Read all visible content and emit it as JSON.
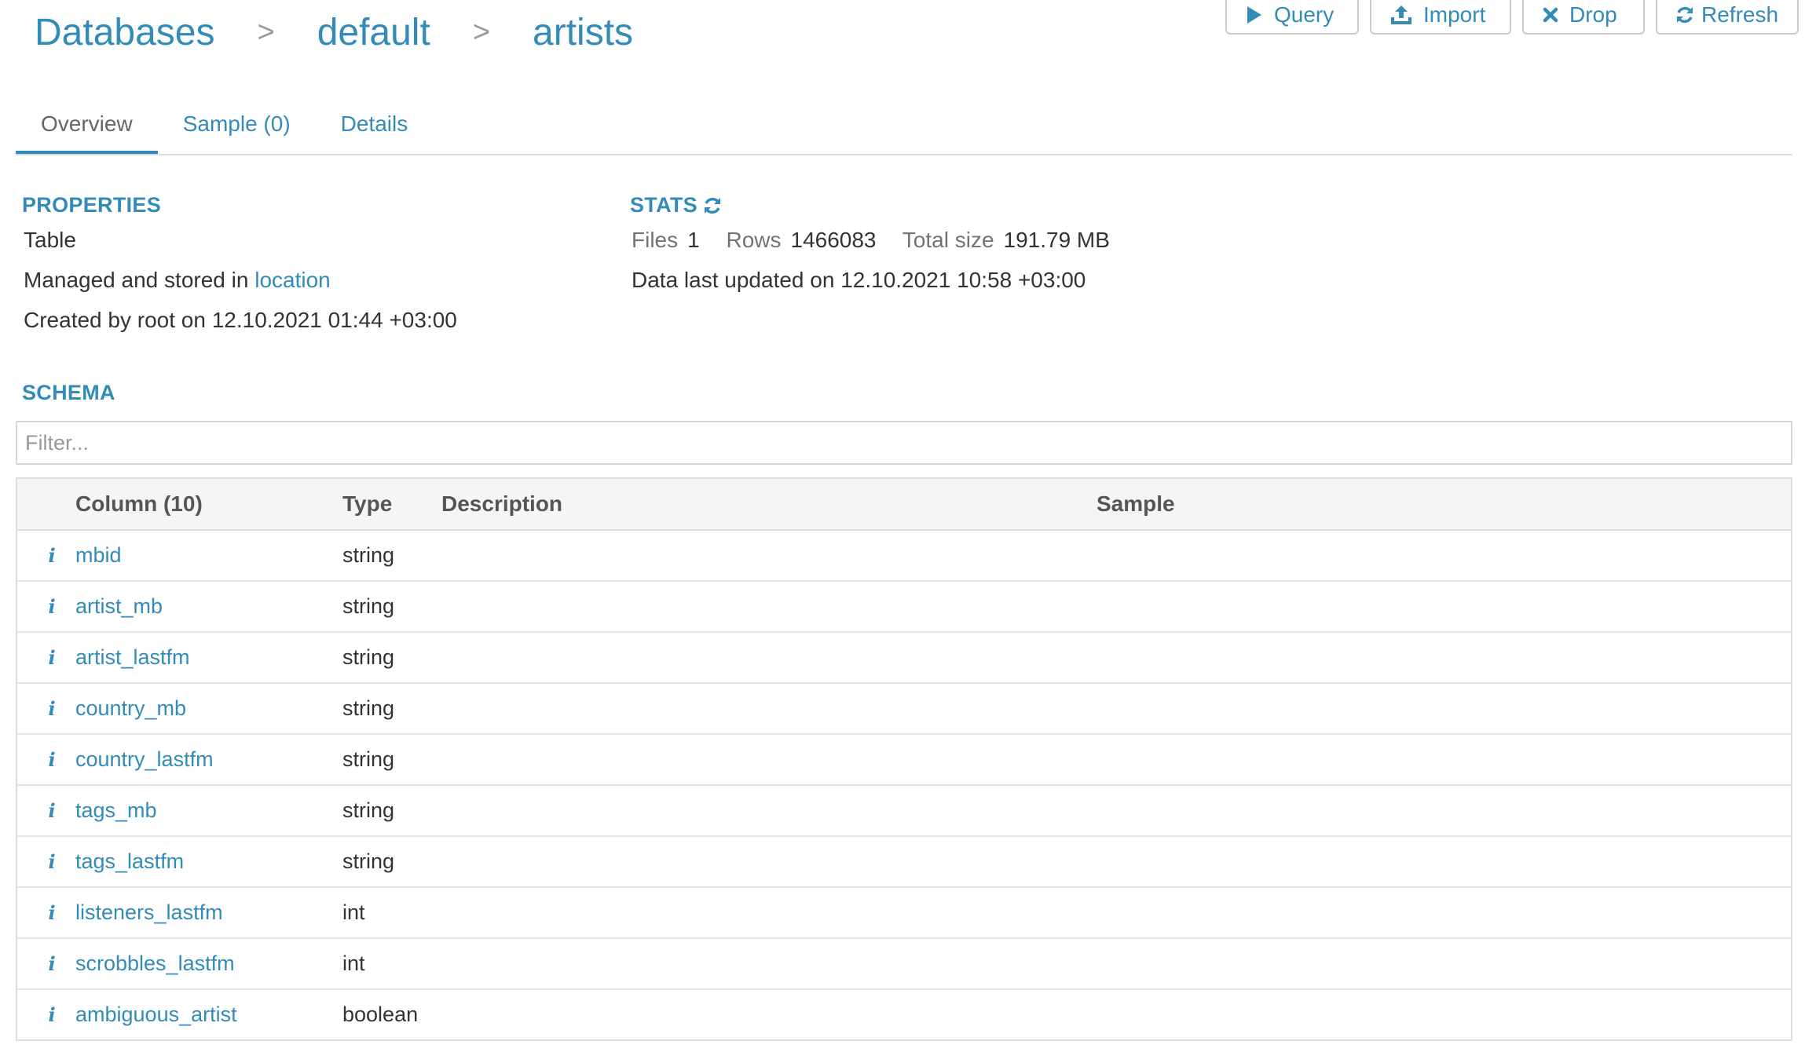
{
  "breadcrumb": {
    "databases": "Databases",
    "database": "default",
    "table": "artists",
    "separator": ">"
  },
  "toolbar": {
    "query_label": "Query",
    "import_label": "Import",
    "drop_label": "Drop",
    "refresh_label": "Refresh"
  },
  "tabs": {
    "overview": "Overview",
    "sample": "Sample (0)",
    "details": "Details"
  },
  "properties": {
    "title": "PROPERTIES",
    "type": "Table",
    "managed_prefix": "Managed and stored in",
    "location_link": "location",
    "created": "Created by root on 12.10.2021 01:44 +03:00"
  },
  "stats": {
    "title": "STATS",
    "files_label": "Files",
    "files_value": "1",
    "rows_label": "Rows",
    "rows_value": "1466083",
    "size_label": "Total size",
    "size_value": "191.79 MB",
    "updated": "Data last updated on 12.10.2021 10:58 +03:00"
  },
  "schema": {
    "title": "SCHEMA",
    "filter_placeholder": "Filter...",
    "headers": {
      "column": "Column (10)",
      "type": "Type",
      "description": "Description",
      "sample": "Sample"
    },
    "rows": [
      {
        "name": "mbid",
        "type": "string"
      },
      {
        "name": "artist_mb",
        "type": "string"
      },
      {
        "name": "artist_lastfm",
        "type": "string"
      },
      {
        "name": "country_mb",
        "type": "string"
      },
      {
        "name": "country_lastfm",
        "type": "string"
      },
      {
        "name": "tags_mb",
        "type": "string"
      },
      {
        "name": "tags_lastfm",
        "type": "string"
      },
      {
        "name": "listeners_lastfm",
        "type": "int"
      },
      {
        "name": "scrobbles_lastfm",
        "type": "int"
      },
      {
        "name": "ambiguous_artist",
        "type": "boolean"
      }
    ]
  },
  "colors": {
    "accent": "#338bb8",
    "text": "#333333",
    "muted": "#737373",
    "border": "#dddddd"
  },
  "icons": {
    "query": "play-icon",
    "import": "upload-icon",
    "drop": "x-icon",
    "refresh": "refresh-icon",
    "stats_refresh": "refresh-icon",
    "row_info": "info-icon"
  }
}
